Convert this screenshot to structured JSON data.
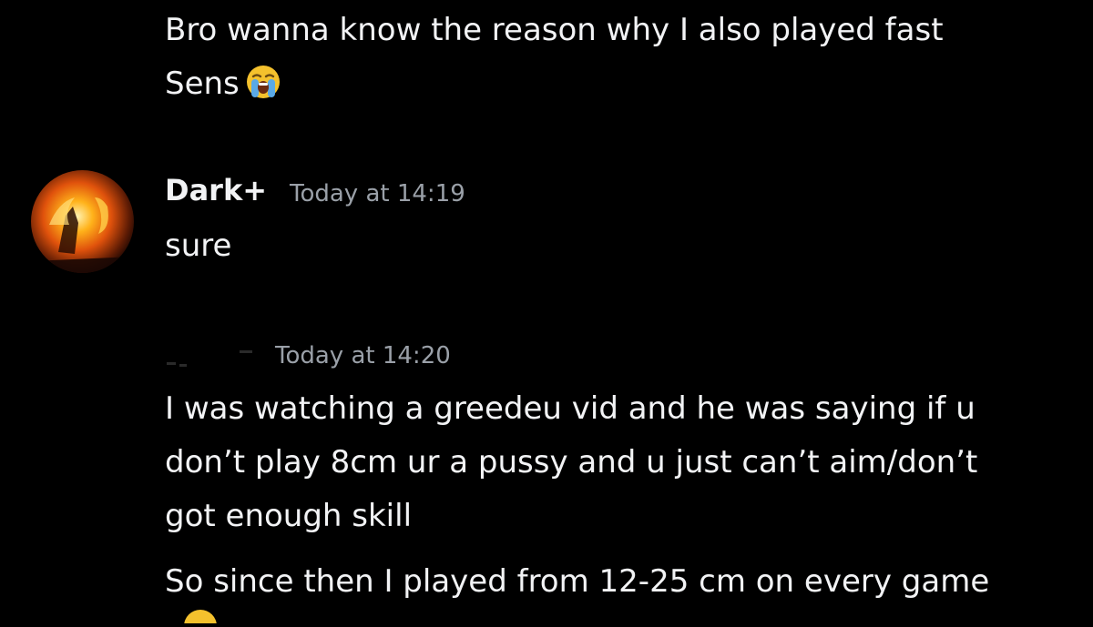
{
  "messages": [
    {
      "id": "continuation",
      "lines": [
        "Bro wanna know the reason why I also played fast",
        "Sens"
      ],
      "emoji": "loudly-crying-face"
    },
    {
      "id": "dark",
      "username": "Dark+",
      "timestamp": "Today at 14:19",
      "avatar": "fire-avatar",
      "lines": [
        "sure"
      ]
    },
    {
      "id": "redacted",
      "username": "",
      "timestamp": "Today at 14:20",
      "lines": [
        "I was watching a greedeu vid and he was saying if u",
        "don’t play 8cm ur a pussy and u just can’t aim/don’t",
        "got enough skill",
        "So since then I played from 12-25 cm on every game"
      ]
    }
  ],
  "colors": {
    "background": "#000000",
    "text": "#f2f3f5",
    "timestamp": "#9aa0a8",
    "emoji_yellow": "#f4c12d",
    "tear_blue": "#5aa9e6"
  }
}
